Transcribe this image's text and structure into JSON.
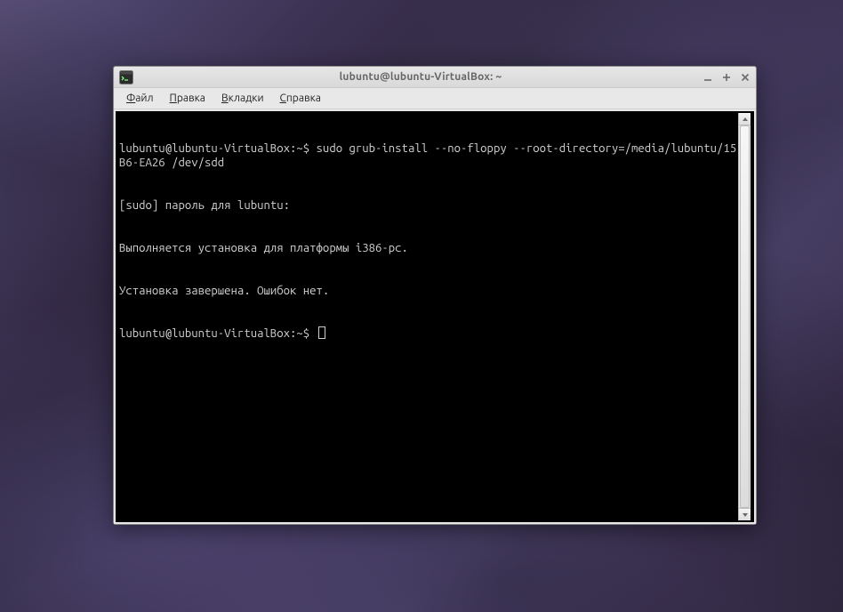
{
  "window": {
    "title": "lubuntu@lubuntu-VirtualBox: ~"
  },
  "menubar": {
    "file": "Файл",
    "edit": "Правка",
    "tabs": "Вкладки",
    "help": "Справка"
  },
  "terminal": {
    "prompt": "lubuntu@lubuntu-VirtualBox:~$ ",
    "lines": [
      "lubuntu@lubuntu-VirtualBox:~$ sudo grub-install --no-floppy --root-directory=/media/lubuntu/15B6-EA26 /dev/sdd",
      "[sudo] пароль для lubuntu:",
      "Выполняется установка для платформы i386-pc.",
      "Установка завершена. Ошибок нет.",
      "lubuntu@lubuntu-VirtualBox:~$ "
    ]
  }
}
